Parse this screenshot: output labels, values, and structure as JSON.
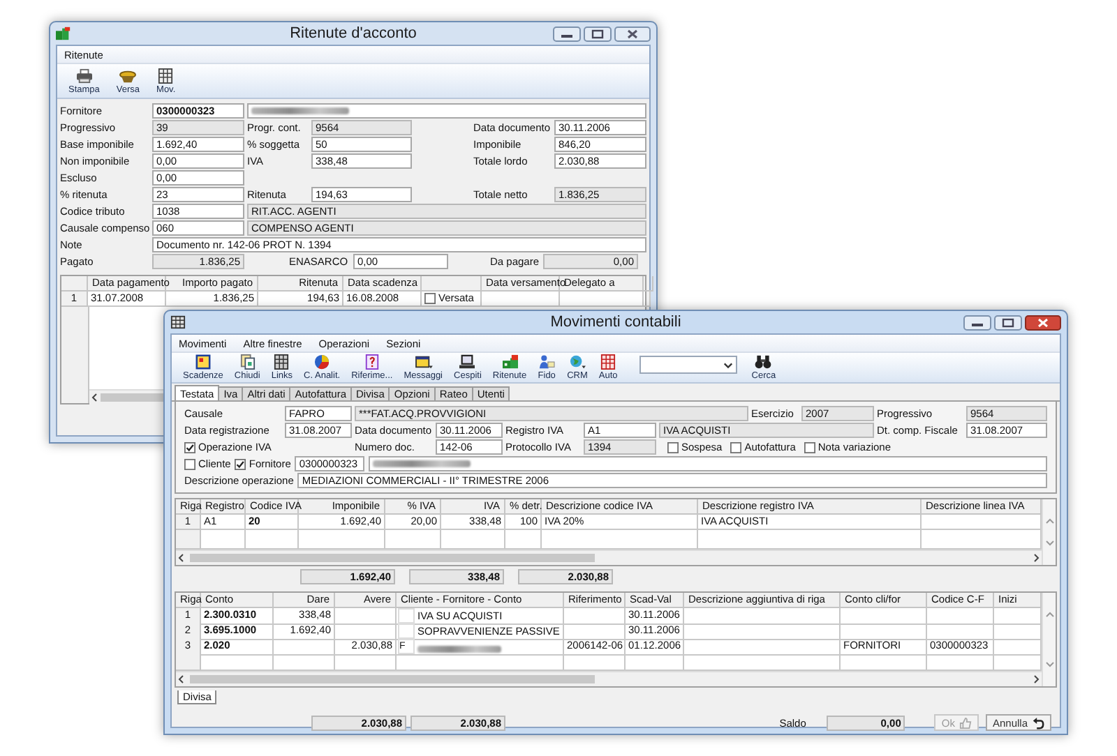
{
  "back_window": {
    "title": "Ritenute d'acconto",
    "menu": [
      {
        "label": "Ritenute"
      }
    ],
    "toolbar": [
      {
        "label": "Stampa"
      },
      {
        "label": "Versa"
      },
      {
        "label": "Mov."
      }
    ],
    "form": [
      {
        "label": "Fornitore",
        "field": {
          "value": "0300000323",
          "readonly": false,
          "bold": true
        },
        "wide": {
          "kind": "blurred",
          "readonly": false
        }
      },
      {
        "label": "Progressivo",
        "field": {
          "value": "39",
          "readonly": true
        },
        "mid": {
          "label": "Progr. cont.",
          "field": {
            "value": "9564",
            "readonly": true
          }
        },
        "right": {
          "label": "Data documento",
          "field": {
            "value": "30.11.2006",
            "readonly": false
          }
        }
      },
      {
        "label": "Base imponibile",
        "field": {
          "value": "1.692,40",
          "readonly": false
        },
        "mid": {
          "label": "% soggetta",
          "field": {
            "value": "50",
            "readonly": false
          }
        },
        "right": {
          "label": "Imponibile",
          "field": {
            "value": "846,20",
            "readonly": false
          }
        }
      },
      {
        "label": "Non imponibile",
        "field": {
          "value": "0,00",
          "readonly": false
        },
        "mid": {
          "label": "IVA",
          "field": {
            "value": "338,48",
            "readonly": false
          }
        },
        "right": {
          "label": "Totale lordo",
          "field": {
            "value": "2.030,88",
            "readonly": false
          }
        }
      },
      {
        "label": "Escluso",
        "field": {
          "value": "0,00",
          "readonly": false
        }
      },
      {
        "label": "% ritenuta",
        "field": {
          "value": "23",
          "readonly": false
        },
        "mid": {
          "label": "Ritenuta",
          "field": {
            "value": "194,63",
            "readonly": false
          }
        },
        "right": {
          "label": "Totale netto",
          "field": {
            "value": "1.836,25",
            "readonly": true
          }
        }
      },
      {
        "label": "Codice tributo",
        "field": {
          "value": "1038",
          "readonly": false
        },
        "wide": {
          "kind": "text",
          "value": "RIT.ACC. AGENTI",
          "readonly": true
        }
      },
      {
        "label": "Causale compenso",
        "field": {
          "value": "060",
          "readonly": false
        },
        "wide": {
          "kind": "text",
          "value": "COMPENSO AGENTI",
          "readonly": true
        }
      },
      {
        "label": "Note",
        "wide": {
          "kind": "text",
          "value": "Documento nr. 142-06 PROT N. 1394",
          "readonly": false
        }
      }
    ],
    "totals": [
      {
        "label": "Pagato",
        "field": {
          "value": "1.836,25",
          "readonly": true
        }
      },
      {
        "label": "ENASARCO",
        "field": {
          "value": "0,00",
          "readonly": false
        }
      },
      {
        "label": "Da pagare",
        "field": {
          "value": "0,00",
          "readonly": true
        }
      }
    ],
    "table": {
      "columns": [
        {
          "label": "Data pagamento"
        },
        {
          "label": "Importo pagato"
        },
        {
          "label": "Ritenuta"
        },
        {
          "label": "Data scadenza"
        },
        {
          "kind": "check"
        },
        {
          "label": "Data versamento"
        },
        {
          "label": "Delegato a"
        }
      ],
      "rows": [
        {
          "num": "1",
          "data_pagamento": "31.07.2008",
          "importo_pagato": "1.836,25",
          "ritenuta": "194,63",
          "data_scadenza": "16.08.2008",
          "versata": {
            "label": "Versata",
            "checked": false
          }
        }
      ]
    }
  },
  "front_window": {
    "title": "Movimenti contabili",
    "menu": [
      {
        "label": "Movimenti"
      },
      {
        "label": "Altre finestre"
      },
      {
        "label": "Operazioni"
      },
      {
        "label": "Sezioni"
      }
    ],
    "toolbar": [
      {
        "kind": "button",
        "label": "Scadenze"
      },
      {
        "kind": "button",
        "label": "Chiudi"
      },
      {
        "kind": "button",
        "label": "Links"
      },
      {
        "kind": "button",
        "label": "C. Analit."
      },
      {
        "kind": "button",
        "label": "Riferime..."
      },
      {
        "kind": "button",
        "label": "Messaggi"
      },
      {
        "kind": "button",
        "label": "Cespiti"
      },
      {
        "kind": "button",
        "label": "Ritenute"
      },
      {
        "kind": "button",
        "label": "Fido"
      },
      {
        "kind": "button",
        "label": "CRM"
      },
      {
        "kind": "button",
        "label": "Auto"
      },
      {
        "kind": "combo"
      },
      {
        "kind": "button",
        "label": "Cerca"
      }
    ],
    "tabs": [
      {
        "label": "Testata",
        "selected": true
      },
      {
        "label": "Iva",
        "selected": false
      },
      {
        "label": "Altri dati",
        "selected": false
      },
      {
        "label": "Autofattura",
        "selected": false
      },
      {
        "label": "Divisa",
        "selected": false
      },
      {
        "label": "Opzioni",
        "selected": false
      },
      {
        "label": "Rateo",
        "selected": false
      },
      {
        "label": "Utenti",
        "selected": false
      }
    ],
    "testata": {
      "causale": {
        "label": "Causale",
        "code": {
          "value": "FAPRO",
          "readonly": false
        },
        "description": {
          "value": "***FAT.ACQ.PROVVIGIONI",
          "readonly": true
        }
      },
      "esercizio": {
        "label": "Esercizio",
        "field": {
          "value": "2007",
          "readonly": true
        }
      },
      "progressivo": {
        "label": "Progressivo",
        "field": {
          "value": "9564",
          "readonly": true
        }
      },
      "data_registrazione": {
        "label": "Data registrazione",
        "field": {
          "value": "31.08.2007",
          "readonly": false
        }
      },
      "data_documento": {
        "label": "Data documento",
        "field": {
          "value": "30.11.2006",
          "readonly": false
        }
      },
      "registro_iva": {
        "label": "Registro IVA",
        "code": {
          "value": "A1",
          "readonly": false
        },
        "description": {
          "value": "IVA ACQUISTI",
          "readonly": true
        }
      },
      "dt_comp_fiscale": {
        "label": "Dt. comp. Fiscale",
        "field": {
          "value": "31.08.2007",
          "readonly": false
        }
      },
      "operazione_iva": {
        "label": "Operazione IVA",
        "checked": true
      },
      "numero_doc": {
        "label": "Numero doc.",
        "field": {
          "value": "142-06",
          "readonly": false
        }
      },
      "protocollo_iva": {
        "label": "Protocollo IVA",
        "field": {
          "value": "1394",
          "readonly": true
        }
      },
      "flags": [
        {
          "label": "Sospesa",
          "checked": false
        },
        {
          "label": "Autofattura",
          "checked": false
        },
        {
          "label": "Nota variazione",
          "checked": false
        }
      ],
      "cliente": {
        "label": "Cliente",
        "checked": false
      },
      "fornitore": {
        "label": "Fornitore",
        "checked": true,
        "code": {
          "value": "0300000323",
          "readonly": false
        }
      },
      "descrizione_operazione": {
        "label": "Descrizione operazione",
        "field": {
          "value": "MEDIAZIONI COMMERCIALI - II° TRIMESTRE 2006",
          "readonly": false
        }
      }
    },
    "iva_table": {
      "columns": [
        "Riga",
        "Registro",
        "Codice IVA",
        "Imponibile",
        "% IVA",
        "IVA",
        "% detr.",
        "Descrizione codice IVA",
        "Descrizione registro IVA",
        "Descrizione linea IVA"
      ],
      "rows": [
        {
          "riga": "1",
          "registro": "A1",
          "codice_iva": "20",
          "imponibile": "1.692,40",
          "perc_iva": "20,00",
          "iva": "338,48",
          "perc_detr": "100",
          "descrizione_codice": "IVA 20%",
          "descrizione_registro": "IVA ACQUISTI"
        }
      ]
    },
    "iva_totals": [
      {
        "value": "1.692,40"
      },
      {
        "value": "338,48"
      },
      {
        "value": "2.030,88"
      }
    ],
    "righe_table": {
      "columns": [
        "Riga",
        "Conto",
        "Dare",
        "Avere",
        "Cliente - Fornitore - Conto",
        "Riferimento",
        "Scad-Val",
        "Descrizione aggiuntiva di riga",
        "Conto cli/for",
        "Codice C-F",
        "Inizi"
      ],
      "rows": [
        {
          "riga": "1",
          "conto": "2.300.0310",
          "dare": "338,48",
          "cliente": {
            "kind": "text",
            "value": "IVA SU ACQUISTI"
          },
          "scad_val": "30.11.2006"
        },
        {
          "riga": "2",
          "conto": "3.695.1000",
          "dare": "1.692,40",
          "cliente": {
            "kind": "text",
            "value": "SOPRAVVENIENZE PASSIVE"
          },
          "scad_val": "30.11.2006"
        },
        {
          "riga": "3",
          "conto": "2.020",
          "avere": "2.030,88",
          "cliente": {
            "kind": "blurred",
            "tipo": "F"
          },
          "riferimento": "2006142-06",
          "scad_val": "01.12.2006",
          "conto_cli_for": "FORNITORI",
          "codice_cf": "0300000323"
        }
      ]
    },
    "bottom_tabs": [
      {
        "label": "Divisa",
        "selected": true
      }
    ],
    "totals": [
      {
        "value": "2.030,88"
      },
      {
        "value": "2.030,88"
      }
    ],
    "saldo": {
      "label": "Saldo",
      "value": "0,00"
    },
    "buttons": [
      {
        "label": "Ok",
        "disabled": true
      },
      {
        "label": "Annulla",
        "disabled": false
      }
    ]
  }
}
